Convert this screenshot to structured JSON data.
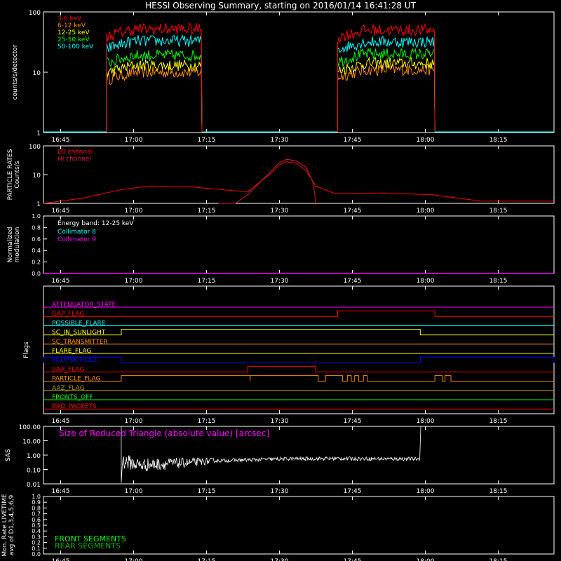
{
  "title": "HESSI Observing Summary, starting on 2016/01/14 16:41:28 UT",
  "time_ticks": [
    "16:45",
    "17:00",
    "17:15",
    "17:30",
    "17:45",
    "18:00",
    "18:15"
  ],
  "colors": {
    "red": "#ff0000",
    "orange": "#ff8c00",
    "yellow": "#ffff00",
    "green": "#00ff00",
    "cyan": "#00ffff",
    "magenta": "#ff00ff",
    "hi_channel": "#dc143c",
    "blue": "#0000ff",
    "olive": "#b5a000",
    "front": "#00ff00",
    "rear": "#00b400"
  },
  "chart_data": [
    {
      "type": "line",
      "panel": "count rates",
      "ylabel": "counts/s/detector",
      "y_scale": "log",
      "ylim": [
        1,
        100
      ],
      "y_ticks": [
        "1",
        "10",
        "100"
      ],
      "x_unit": "minutes after 16:41:28 UT",
      "xlim": [
        0,
        105
      ],
      "intervals": [
        [
          13.0,
          32.6
        ],
        [
          60.5,
          80.5
        ]
      ],
      "series": [
        {
          "name": "3-6 keV",
          "color": "red",
          "values": [
            52,
            50
          ]
        },
        {
          "name": "6-12 keV",
          "color": "orange",
          "values": [
            10,
            11
          ]
        },
        {
          "name": "12-25 keV",
          "color": "yellow",
          "values": [
            13,
            14
          ]
        },
        {
          "name": "25-50 keV",
          "color": "green",
          "values": [
            19,
            20
          ]
        },
        {
          "name": "50-100 keV",
          "color": "cyan",
          "values": [
            33,
            32
          ]
        }
      ]
    },
    {
      "type": "line",
      "panel": "particle rates",
      "ylabel": "PARTICLE RATES\nCounts/s",
      "y_scale": "log",
      "ylim": [
        1,
        100
      ],
      "y_ticks": [
        "1",
        "10",
        "100"
      ],
      "series": [
        {
          "name": "LO channel",
          "color": "red",
          "x": [
            0,
            8,
            16,
            22,
            30,
            42,
            47,
            48.5,
            50,
            52,
            54,
            56,
            60,
            70,
            80,
            90,
            105
          ],
          "y": [
            1,
            1.5,
            3,
            4,
            3.8,
            2.5,
            12,
            22,
            28,
            25,
            14,
            4,
            2.2,
            2.3,
            2,
            1.2,
            1.2
          ]
        },
        {
          "name": "HI channel",
          "color": "hi_channel",
          "x": [
            36,
            39.5,
            42,
            47,
            48.5,
            50,
            52,
            54,
            55.5,
            56
          ],
          "y": [
            1,
            1,
            2,
            14,
            26,
            34,
            30,
            18,
            5,
            1
          ]
        }
      ]
    },
    {
      "type": "line",
      "panel": "modulation",
      "ylabel": "Normalized\nmodulation",
      "ylim": [
        0,
        1
      ],
      "y_ticks": [
        "0.0",
        "0.2",
        "0.4",
        "0.6",
        "0.8",
        "1.0"
      ],
      "annotation": "Energy band: 12-25 keV",
      "series": [
        {
          "name": "Collimator 8",
          "color": "cyan",
          "values": []
        },
        {
          "name": "Collimator 9",
          "color": "magenta",
          "values": [
            0,
            0
          ]
        }
      ]
    },
    {
      "type": "line",
      "panel": "flags",
      "ylabel": "Flags",
      "flags": [
        {
          "name": "ATTENUATOR_STATE",
          "color": "magenta",
          "high": []
        },
        {
          "name": "GAP_FLAG",
          "color": "red",
          "high": [
            [
              60.5,
              80.5
            ]
          ]
        },
        {
          "name": "POSSIBLE_FLARE",
          "color": "cyan",
          "high": []
        },
        {
          "name": "SC_IN_SUNLIGHT",
          "color": "yellow",
          "high": [
            [
              16.0,
              77.5
            ]
          ]
        },
        {
          "name": "SC_TRANSMITTER",
          "color": "orange",
          "high": []
        },
        {
          "name": "FLARE_FLAG",
          "color": "yellow",
          "high": []
        },
        {
          "name": "ECLIPSE_FLAG",
          "color": "blue",
          "high": [
            [
              0,
              16.0
            ],
            [
              77.5,
              105
            ]
          ]
        },
        {
          "name": "SAA_FLAG",
          "color": "red",
          "high": [
            [
              42,
              56
            ]
          ]
        },
        {
          "name": "PARTICLE_FLAG",
          "color": "orange",
          "high": [
            [
              16,
              42.5
            ],
            [
              42.5,
              56.5
            ],
            [
              58,
              61.5
            ],
            [
              62.5,
              63.3
            ],
            [
              64,
              64.8
            ],
            [
              65.8,
              66.6
            ],
            [
              80.5,
              82
            ],
            [
              82.6,
              83.8
            ]
          ]
        },
        {
          "name": "AAZ_FLAG",
          "color": "olive",
          "high": []
        },
        {
          "name": "FRONTS_OFF",
          "color": "green",
          "high": []
        },
        {
          "name": "BAD_PACKETS",
          "color": "red",
          "high": []
        }
      ]
    },
    {
      "type": "line",
      "panel": "SAS",
      "ylabel": "SAS",
      "y_scale": "log",
      "ylim": [
        0.01,
        100
      ],
      "y_ticks": [
        "0.01",
        "0.10",
        "1.00",
        "10.00",
        "100.00"
      ],
      "annotation": "Size of Reduced Triangle (absolute value) [arcsec]",
      "series": [
        {
          "name": "",
          "color": "white",
          "x": [
            16.0,
            16.2,
            20,
            25,
            30,
            35,
            40,
            45,
            50,
            60,
            70,
            77.4,
            77.6
          ],
          "y": [
            100,
            0.4,
            0.2,
            0.25,
            0.3,
            0.4,
            0.45,
            0.5,
            0.55,
            0.58,
            0.55,
            0.55,
            100
          ]
        }
      ]
    },
    {
      "type": "line",
      "panel": "livetime",
      "ylabel": "Mon. Rate LIVETIME\navg of D1,3,4,5,6,9",
      "ylim": [
        0,
        1
      ],
      "y_ticks": [
        "0.0",
        "0.1",
        "0.2",
        "0.3",
        "0.4",
        "0.5",
        "0.6",
        "0.7",
        "0.8",
        "0.9",
        "1.0"
      ],
      "series": [
        {
          "name": "FRONT SEGMENTS",
          "color": "front",
          "values": []
        },
        {
          "name": "REAR SEGMENTS",
          "color": "rear",
          "values": []
        }
      ]
    }
  ]
}
